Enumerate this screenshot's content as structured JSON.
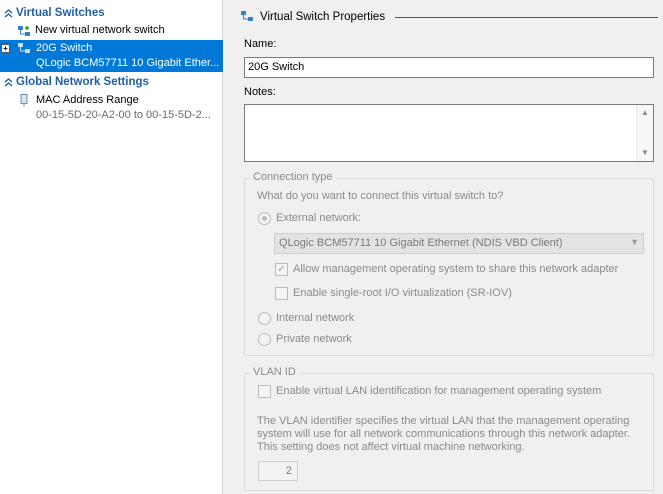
{
  "left": {
    "sections": [
      {
        "title": "Virtual Switches"
      },
      {
        "title": "Global Network Settings"
      }
    ],
    "new_switch": "New virtual network switch",
    "switch": {
      "name": "20G Switch",
      "adapter": "QLogic BCM57711 10 Gigabit Ether..."
    },
    "mac": {
      "label": "MAC Address Range",
      "value": "00-15-5D-20-A2-00 to 00-15-5D-2..."
    }
  },
  "right": {
    "header": "Virtual Switch Properties",
    "name_label": "Name:",
    "name_value": "20G Switch",
    "notes_label": "Notes:",
    "notes_value": "",
    "connection": {
      "title": "Connection type",
      "question": "What do you want to connect this virtual switch to?",
      "external": "External network:",
      "adapter": "QLogic BCM57711 10 Gigabit Ethernet (NDIS VBD Client)",
      "allow_mgmt": "Allow management operating system to share this network adapter",
      "sriov": "Enable single-root I/O virtualization (SR-IOV)",
      "internal": "Internal network",
      "private": "Private network"
    },
    "vlan": {
      "title": "VLAN ID",
      "enable": "Enable virtual LAN identification for management operating system",
      "desc1": "The VLAN identifier specifies the virtual LAN that the management operating",
      "desc2": "system will use for all network communications through this network adapter.",
      "desc3": "This setting does not affect virtual machine networking.",
      "value": "2"
    }
  },
  "colors": {
    "selection": "#0078d7",
    "section": "#1f5fa8"
  }
}
